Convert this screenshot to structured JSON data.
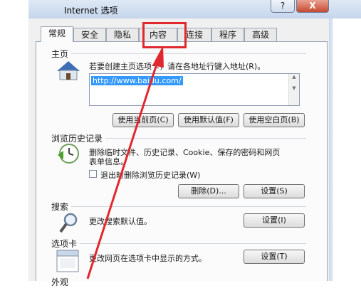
{
  "window": {
    "title": "Internet 选项",
    "help_glyph": "?",
    "close_glyph": "X"
  },
  "tabs": [
    "常规",
    "安全",
    "隐私",
    "内容",
    "连接",
    "程序",
    "高级"
  ],
  "home": {
    "heading": "主页",
    "description": "若要创建主页选项卡，请在各地址行键入地址(R)。",
    "url": "http://www.baidu.com/",
    "buttons": [
      "使用当前页(C)",
      "使用默认值(F)",
      "使用空白页(B)"
    ]
  },
  "history": {
    "heading": "浏览历史记录",
    "description_line1": "删除临时文件、历史记录、Cookie、保存的密码和网页",
    "description_line2": "表单信息。",
    "checkbox_label": "退出时删除浏览历史记录(W)",
    "delete_button": "删除(D)...",
    "settings_button": "设置(S)"
  },
  "search": {
    "heading": "搜索",
    "description": "更改搜索默认值。",
    "settings_button": "设置(I)"
  },
  "tabsection": {
    "heading": "选项卡",
    "description": "更改网页在选项卡中显示的方式。",
    "settings_button": "设置(T)"
  },
  "next_section_partial": "外观",
  "annotation": {
    "color": "#e0282e",
    "highlighted_tab": "内容"
  }
}
